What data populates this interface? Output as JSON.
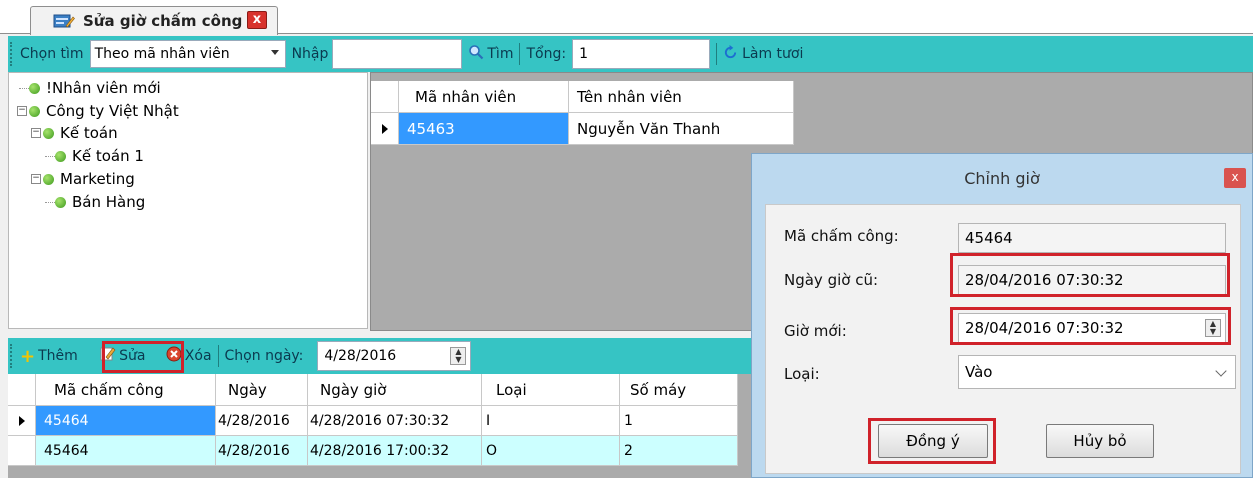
{
  "tab": {
    "title": "Sửa giờ chấm công",
    "close_label": "x"
  },
  "search_toolbar": {
    "choose_label": "Chọn tìm",
    "choose_value": "Theo mã nhân viên",
    "input_label": "Nhập",
    "input_value": "",
    "search_button": "Tìm",
    "total_label": "Tổng:",
    "total_value": "1",
    "refresh_button": "Làm tươi"
  },
  "tree": {
    "nodes": [
      {
        "label": "!Nhân viên mới"
      },
      {
        "label": "Công ty Việt Nhật"
      },
      {
        "label": "Kế toán"
      },
      {
        "label": "Kế toán 1"
      },
      {
        "label": "Marketing"
      },
      {
        "label": "Bán Hàng"
      }
    ]
  },
  "employee_grid": {
    "columns": [
      "Mã nhân viên",
      "Tên nhân viên"
    ],
    "rows": [
      [
        "45463",
        "Nguyễn Văn Thanh"
      ]
    ]
  },
  "action_toolbar": {
    "add_button": "Thêm",
    "edit_button": "Sửa",
    "delete_button": "Xóa",
    "date_label": "Chọn ngày:",
    "date_value": "4/28/2016"
  },
  "attendance_grid": {
    "columns": [
      "Mã chấm công",
      "Ngày",
      "Ngày giờ",
      "Loại",
      "Số máy"
    ],
    "rows": [
      [
        "45464",
        "4/28/2016",
        "4/28/2016 07:30:32",
        "I",
        "1"
      ],
      [
        "45464",
        "4/28/2016",
        "4/28/2016 17:00:32",
        "O",
        "2"
      ]
    ]
  },
  "dialog": {
    "title": "Chỉnh giờ",
    "close_label": "x",
    "code_label": "Mã chấm công:",
    "code_value": "45464",
    "old_label": "Ngày giờ cũ:",
    "old_value": "28/04/2016 07:30:32",
    "new_label": "Giờ mới:",
    "new_value": "28/04/2016 07:30:32",
    "type_label": "Loại:",
    "type_value": "Vào",
    "ok_button": "Đồng ý",
    "cancel_button": "Hủy bỏ"
  },
  "colors": {
    "toolbar": "#36c4c4",
    "highlight": "#d0222a",
    "selected_row": "#3399ff",
    "alt_row": "#ccffff"
  }
}
